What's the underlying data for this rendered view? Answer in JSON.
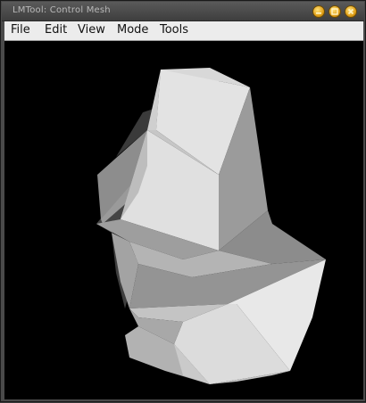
{
  "window": {
    "title": "LMTool: Control Mesh",
    "buttons": [
      "minimize",
      "maximize",
      "close"
    ]
  },
  "menubar": {
    "items": [
      {
        "label": "File"
      },
      {
        "label": "Edit"
      },
      {
        "label": "View"
      },
      {
        "label": "Mode"
      },
      {
        "label": "Tools"
      }
    ]
  },
  "viewport": {
    "background": "#000000",
    "content": "shaded 3D control mesh (grayscale)"
  },
  "colors": {
    "titlebar": "#4a4a4a",
    "title_text": "#b9b9b9",
    "window_button": "#e1a018",
    "menubar": "#ececec"
  }
}
